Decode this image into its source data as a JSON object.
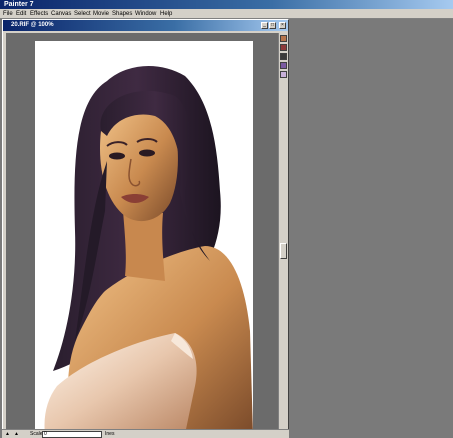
{
  "app": {
    "title": "Painter 7"
  },
  "menu": {
    "items": [
      "File",
      "Edit",
      "Effects",
      "Canvas",
      "Select",
      "Movie",
      "Shapes",
      "Window",
      "Help"
    ]
  },
  "document": {
    "title": "20.RIF @ 100%",
    "controls": {
      "minimize": "_",
      "maximize": "□",
      "close": "×"
    }
  },
  "status": {
    "scale_label": "Scale",
    "scale_value": "0",
    "units": "Ines"
  },
  "colors": {
    "swatches": [
      "#b5734a",
      "#8c3a3a",
      "#3a3a3a",
      "#7a5aa0",
      "#c8b0d8"
    ]
  },
  "icons": {
    "portrait": "painted-portrait-image"
  }
}
